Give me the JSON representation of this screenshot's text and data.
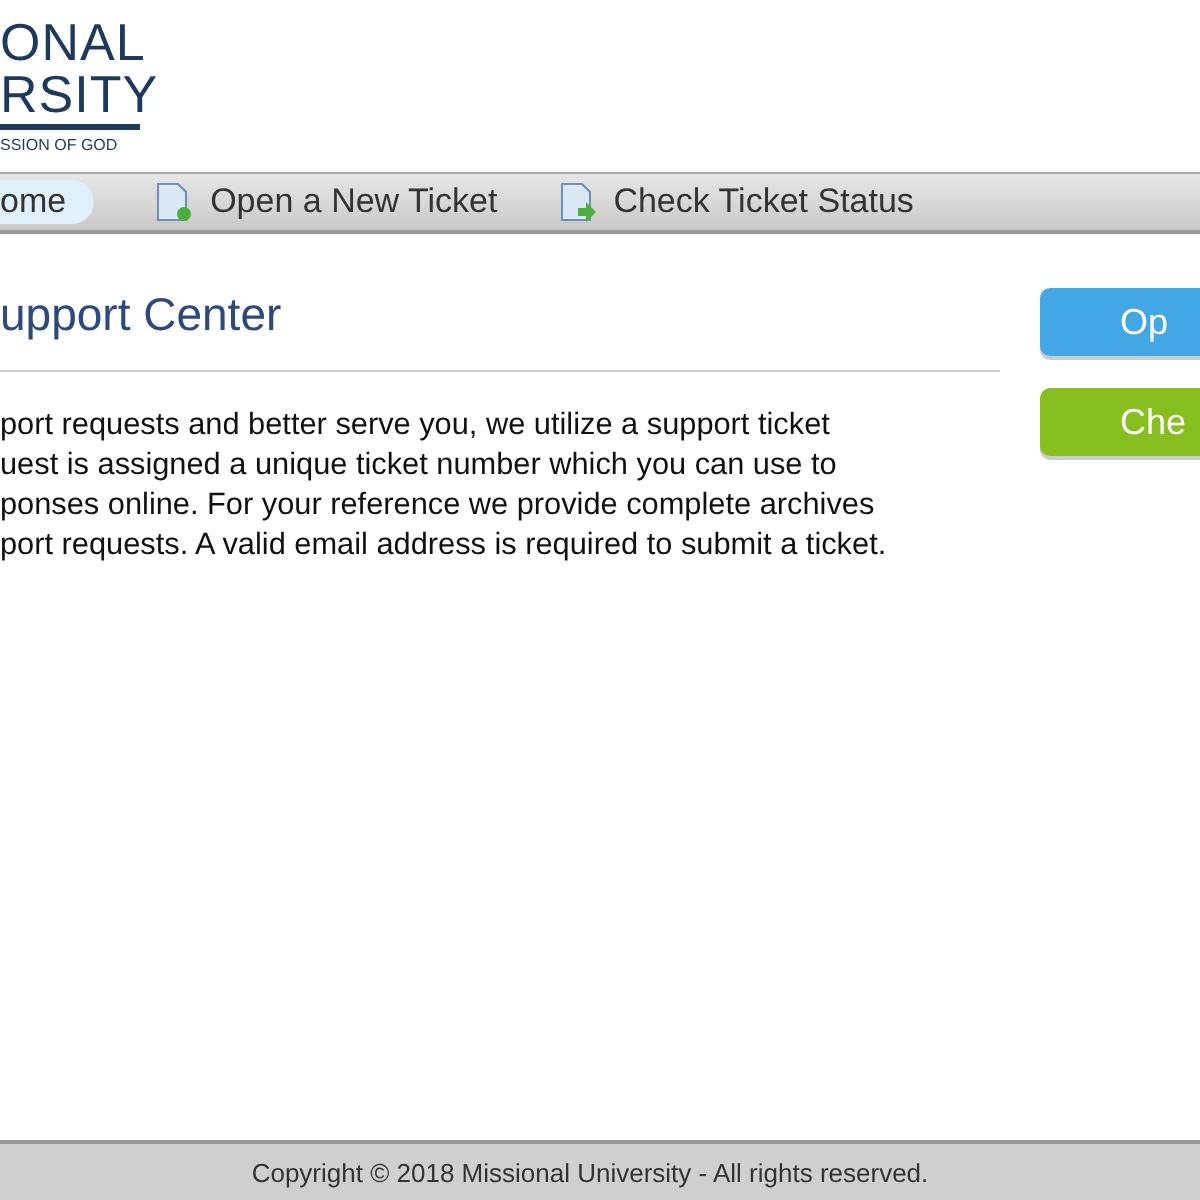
{
  "logo": {
    "line_1": "ONAL",
    "line_2": "RSITY",
    "tagline": "SSION OF GOD"
  },
  "nav": [
    {
      "label": "ome",
      "selected": true,
      "kind": "plain"
    },
    {
      "label": "Open a New Ticket",
      "selected": false,
      "kind": "new"
    },
    {
      "label": "Check Ticket Status",
      "selected": false,
      "kind": "status"
    }
  ],
  "heading": "upport Center",
  "intro": "port requests and better serve you, we utilize a support ticket\nuest is assigned a unique ticket number which you can use to\nponses online. For your reference we provide complete archives\nport requests. A valid email address is required to submit a ticket.",
  "buttons": [
    {
      "label": "Op",
      "kind": "blue"
    },
    {
      "label": "Che",
      "kind": "green"
    }
  ],
  "footer": "Copyright © 2018 Missional University - All rights reserved."
}
